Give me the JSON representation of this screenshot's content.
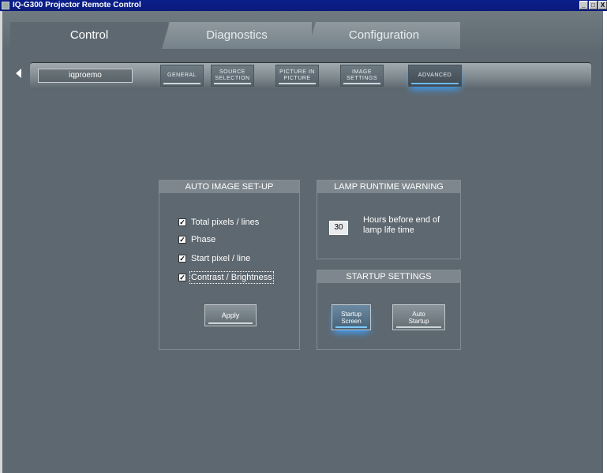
{
  "window": {
    "title": "IQ-G300 Projector Remote Control",
    "controls": [
      "_",
      "□",
      "X"
    ]
  },
  "tabs": [
    {
      "label": "Control",
      "active": true
    },
    {
      "label": "Diagnostics",
      "active": false
    },
    {
      "label": "Configuration",
      "active": false
    }
  ],
  "subnav": {
    "device": "iqproemo",
    "buttons": [
      {
        "label": "GENERAL",
        "active": false
      },
      {
        "label": "SOURCE\nSELECTION",
        "active": false
      },
      {
        "label": "PICTURE IN\nPICTURE",
        "active": false
      },
      {
        "label": "IMAGE\nSETTINGS",
        "active": false
      },
      {
        "label": "ADVANCED",
        "active": true
      }
    ]
  },
  "auto_image": {
    "title": "AUTO IMAGE SET-UP",
    "options": [
      {
        "label": "Total pixels / lines",
        "checked": true
      },
      {
        "label": "Phase",
        "checked": true
      },
      {
        "label": "Start pixel / line",
        "checked": true
      },
      {
        "label": "Contrast / Brightness",
        "checked": true
      }
    ],
    "apply_label": "Apply"
  },
  "lamp_warning": {
    "title": "LAMP RUNTIME WARNING",
    "hours": "30",
    "description": "Hours before end of lamp life time"
  },
  "startup": {
    "title": "STARTUP SETTINGS",
    "buttons": [
      {
        "label": "Startup\nScreen",
        "active": true
      },
      {
        "label": "Auto\nStartup",
        "active": false
      }
    ]
  }
}
